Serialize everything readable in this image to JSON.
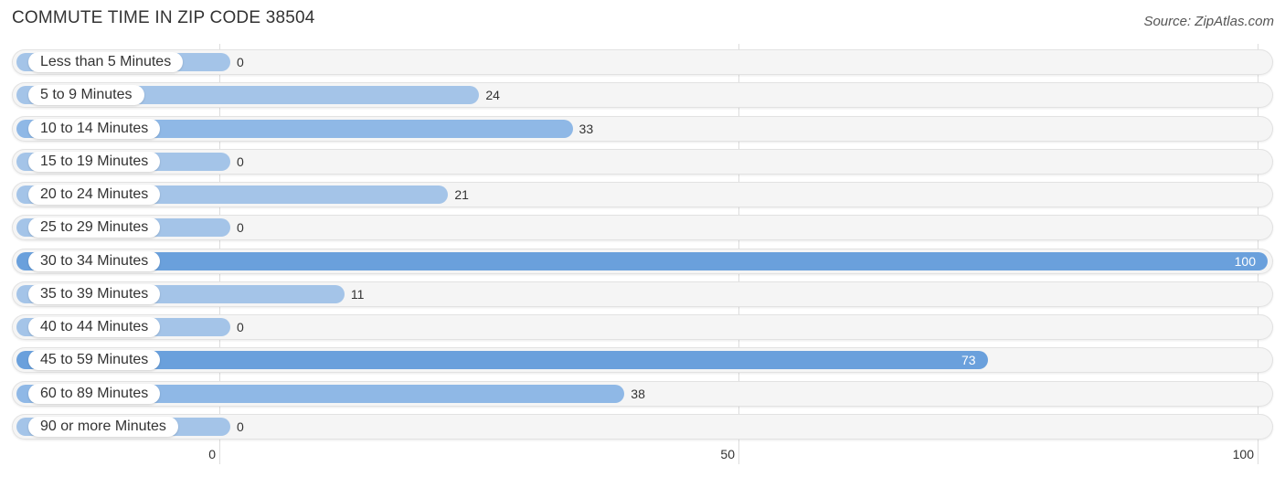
{
  "header": {
    "title": "COMMUTE TIME IN ZIP CODE 38504",
    "source": "Source: ZipAtlas.com"
  },
  "colors": {
    "bar_light": "#a4c4e8",
    "bar_strong": "#6aa0dc",
    "track": "#f5f5f5"
  },
  "chart_data": {
    "type": "bar",
    "orientation": "horizontal",
    "title": "COMMUTE TIME IN ZIP CODE 38504",
    "xlabel": "",
    "ylabel": "",
    "xlim": [
      0,
      100
    ],
    "x_ticks": [
      "0",
      "50",
      "100"
    ],
    "grid": true,
    "categories": [
      "Less than 5 Minutes",
      "5 to 9 Minutes",
      "10 to 14 Minutes",
      "15 to 19 Minutes",
      "20 to 24 Minutes",
      "25 to 29 Minutes",
      "30 to 34 Minutes",
      "35 to 39 Minutes",
      "40 to 44 Minutes",
      "45 to 59 Minutes",
      "60 to 89 Minutes",
      "90 or more Minutes"
    ],
    "values": [
      0,
      24,
      33,
      0,
      21,
      0,
      100,
      11,
      0,
      73,
      38,
      0
    ],
    "value_labels": [
      "0",
      "24",
      "33",
      "0",
      "21",
      "0",
      "100",
      "11",
      "0",
      "73",
      "38",
      "0"
    ]
  }
}
